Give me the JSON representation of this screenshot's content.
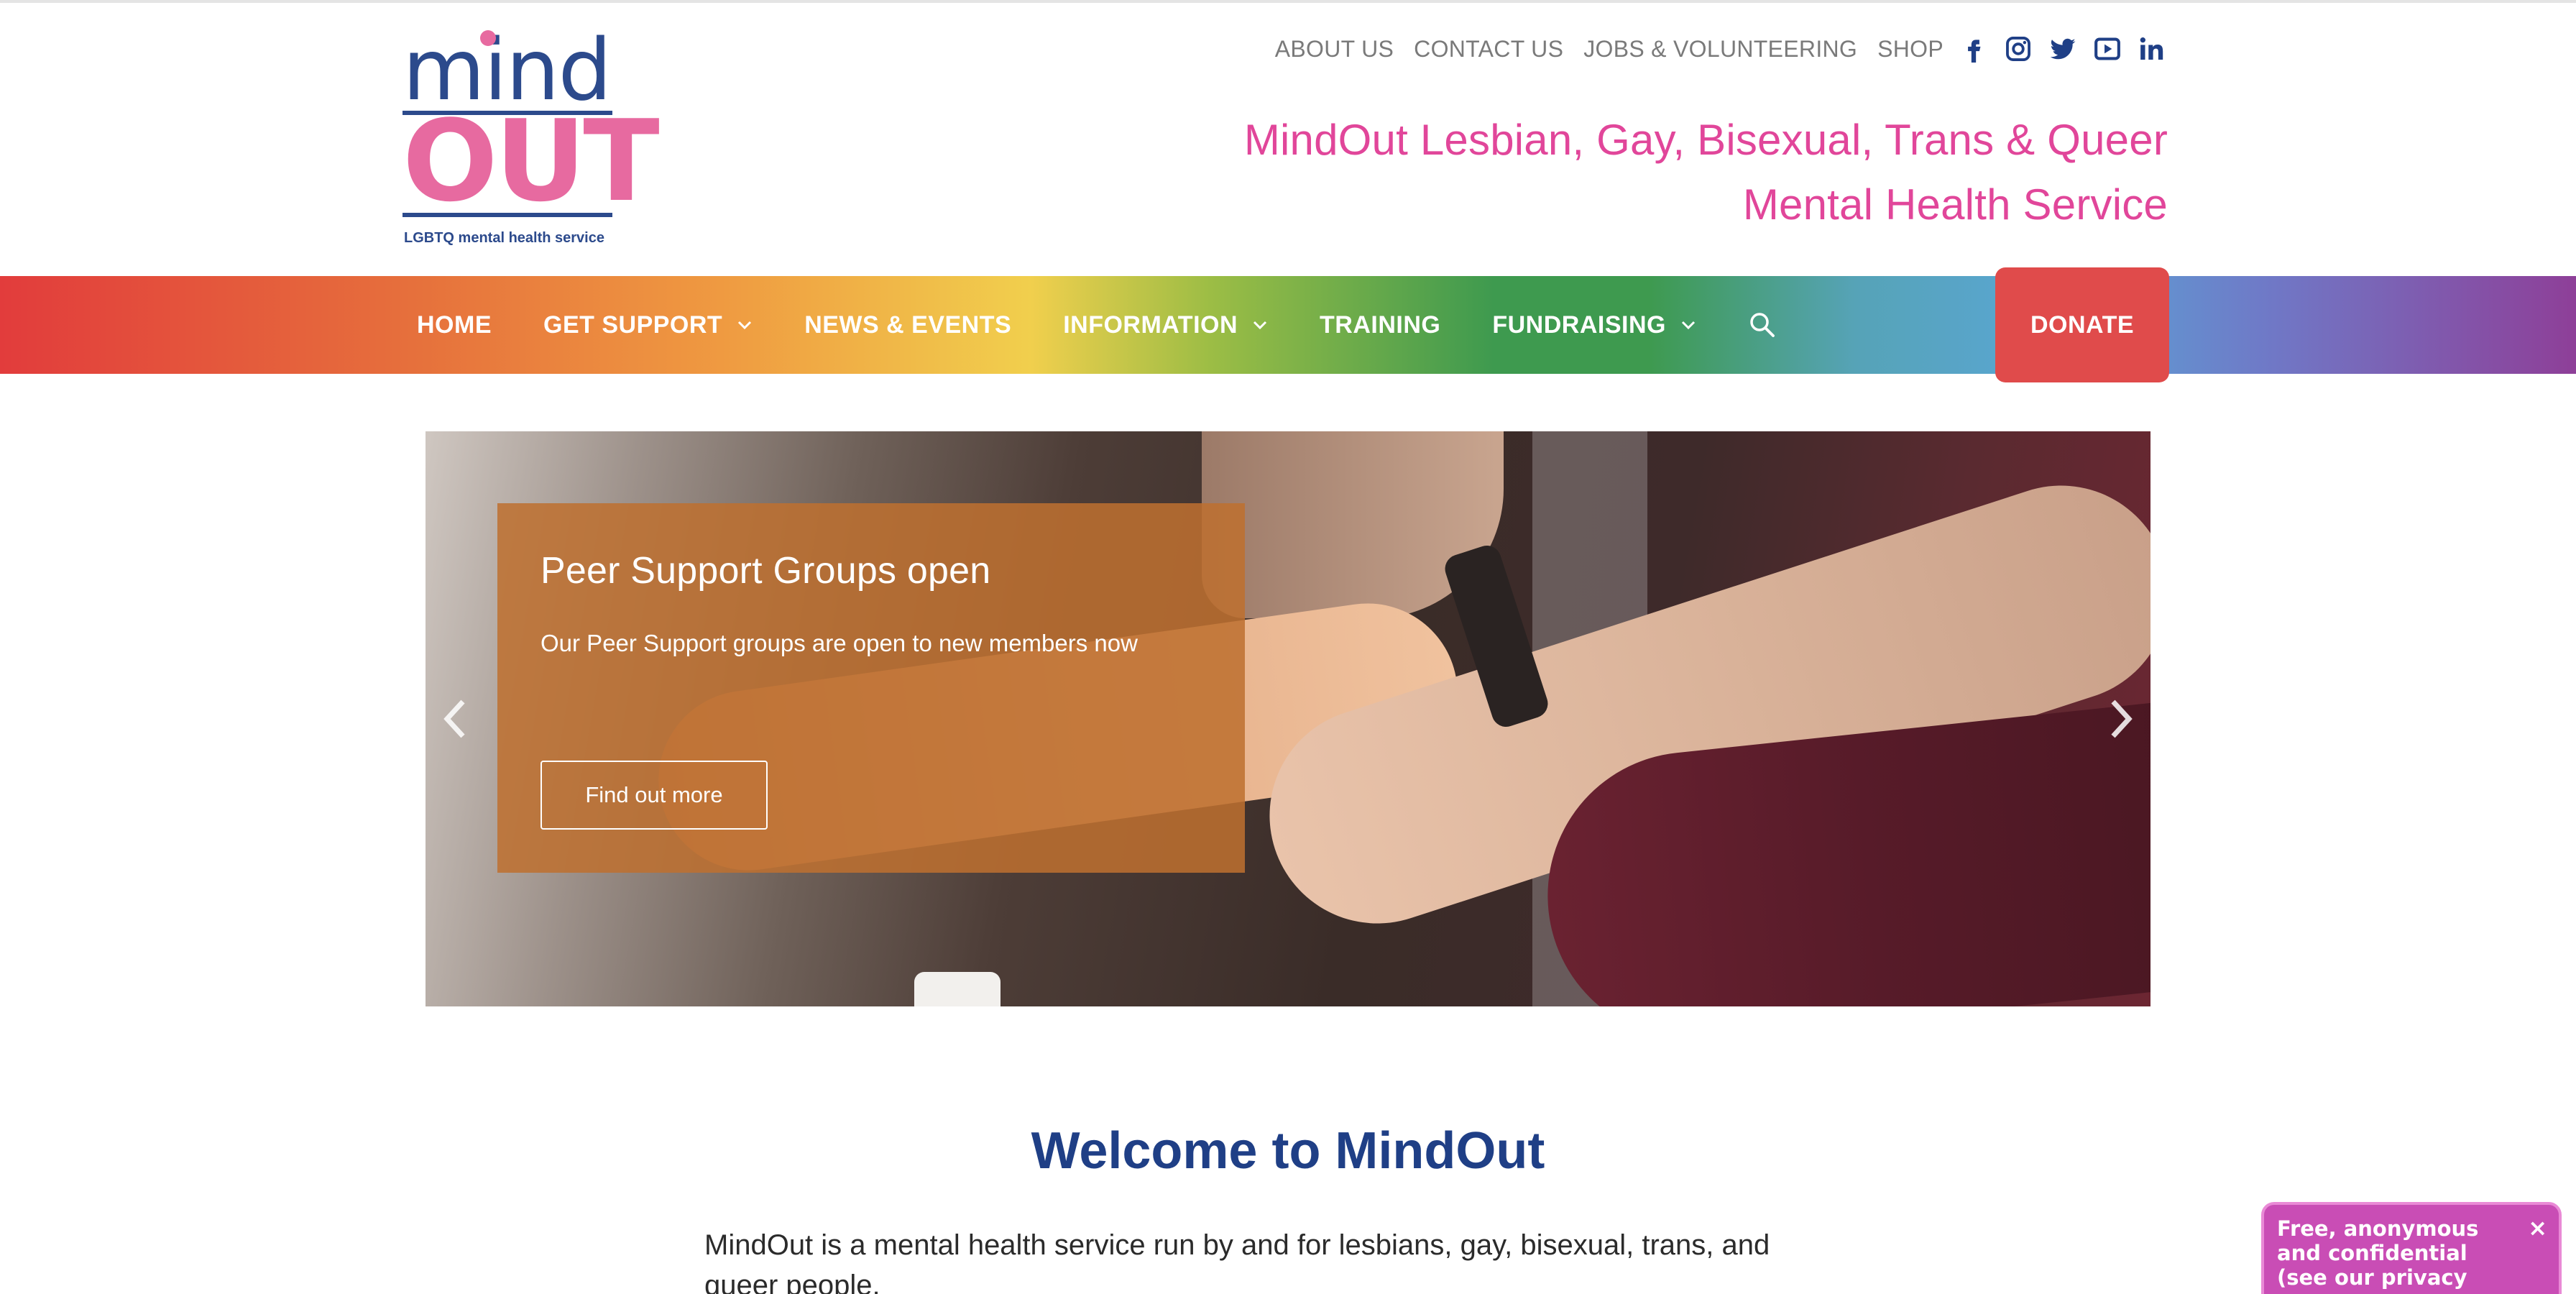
{
  "logo": {
    "word1": "mind",
    "word2": "OUT",
    "tagline": "LGBTQ mental health service"
  },
  "topnav": {
    "links": [
      "ABOUT US",
      "CONTACT US",
      "JOBS & VOLUNTEERING",
      "SHOP"
    ],
    "social_icons": [
      "facebook-icon",
      "instagram-icon",
      "twitter-icon",
      "youtube-icon",
      "linkedin-icon"
    ]
  },
  "header": {
    "tagline_line1": "MindOut Lesbian, Gay, Bisexual, Trans & Queer",
    "tagline_line2": "Mental Health Service"
  },
  "nav": {
    "items": [
      {
        "label": "HOME",
        "dropdown": false
      },
      {
        "label": "GET SUPPORT",
        "dropdown": true
      },
      {
        "label": "NEWS & EVENTS",
        "dropdown": false
      },
      {
        "label": "INFORMATION",
        "dropdown": true
      },
      {
        "label": "TRAINING",
        "dropdown": false
      },
      {
        "label": "FUNDRAISING",
        "dropdown": true
      }
    ],
    "donate_label": "DONATE"
  },
  "hero": {
    "title": "Peer Support Groups open",
    "subtitle": "Our Peer Support groups are open to new members now",
    "button_label": "Find out more"
  },
  "welcome": {
    "heading": "Welcome to MindOut",
    "intro": "MindOut is a mental health service run by and for lesbians, gay, bisexual, trans, and queer people."
  },
  "chat": {
    "message": "Free, anonymous and confidential (see our privacy",
    "close": "×"
  },
  "colors": {
    "brand_blue": "#1f3f86",
    "brand_pink": "#e1469a",
    "donate_red": "#e04b4b",
    "overlay_orange": "#be7030",
    "chat_magenta": "#c94db5"
  }
}
